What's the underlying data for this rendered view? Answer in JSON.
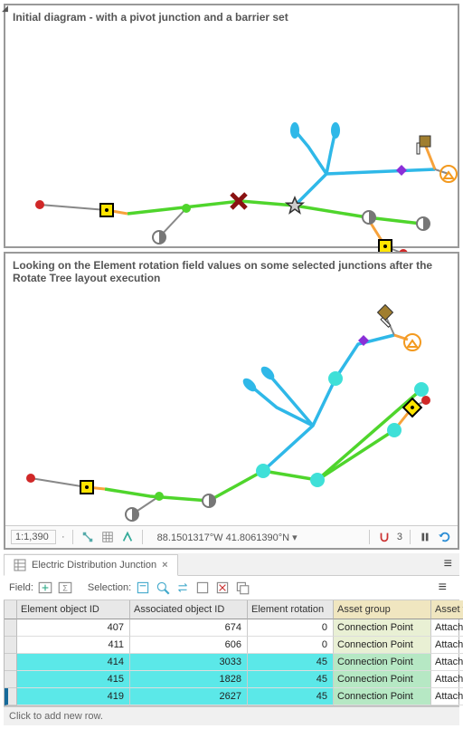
{
  "panel1": {
    "title": "Initial diagram - with a pivot junction and a barrier set"
  },
  "panel2": {
    "title": "Looking on the Element rotation field values on some selected junctions after the Rotate Tree layout execution"
  },
  "toolbar": {
    "scale": "1:1,390",
    "coords": "88.1501317°W 41.8061390°N",
    "snapValue": "3"
  },
  "tab": {
    "title": "Electric Distribution Junction"
  },
  "fieldBar": {
    "fieldLabel": "Field:",
    "selectionLabel": "Selection:"
  },
  "table": {
    "headers": {
      "c1": "Element object ID",
      "c2": "Associated object ID",
      "c3": "Element rotation",
      "c4": "Asset group",
      "c5": "Asset type"
    },
    "rows": [
      {
        "c1": "407",
        "c2": "674",
        "c3": "0",
        "c4": "Connection Point",
        "c5": "Attachment",
        "hl": false,
        "sel": false
      },
      {
        "c1": "411",
        "c2": "606",
        "c3": "0",
        "c4": "Connection Point",
        "c5": "Attachment",
        "hl": false,
        "sel": false
      },
      {
        "c1": "414",
        "c2": "3033",
        "c3": "45",
        "c4": "Connection Point",
        "c5": "Attachment",
        "hl": true,
        "sel": false
      },
      {
        "c1": "415",
        "c2": "1828",
        "c3": "45",
        "c4": "Connection Point",
        "c5": "Attachment",
        "hl": true,
        "sel": false
      },
      {
        "c1": "419",
        "c2": "2627",
        "c3": "45",
        "c4": "Connection Point",
        "c5": "Attachment",
        "hl": true,
        "sel": true
      }
    ],
    "addRowHint": "Click to add new row."
  }
}
